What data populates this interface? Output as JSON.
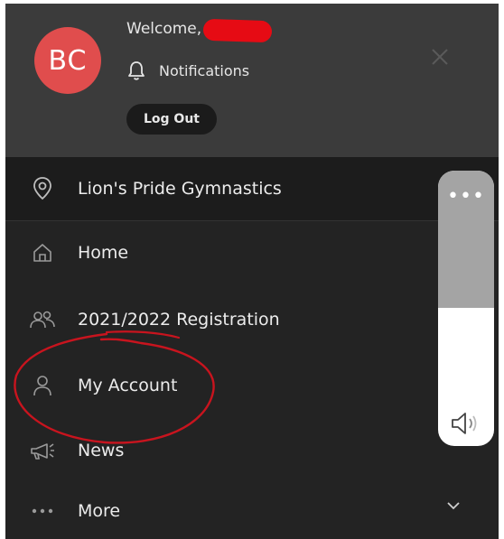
{
  "user": {
    "initials": "BC",
    "welcome": "Welcome,"
  },
  "header": {
    "notifications_label": "Notifications",
    "logout_label": "Log Out"
  },
  "menu": {
    "organization": "Lion's Pride Gymnastics",
    "items": [
      {
        "label": "Home",
        "icon": "home-icon"
      },
      {
        "label": "2021/2022 Registration",
        "icon": "users-icon"
      },
      {
        "label": "My Account",
        "icon": "person-icon"
      },
      {
        "label": "News",
        "icon": "megaphone-icon"
      },
      {
        "label": "More",
        "icon": "dots-icon"
      }
    ]
  },
  "scroll_overlay": {
    "dots": "•••",
    "icon": "speaker-icon"
  },
  "colors": {
    "avatar": "#e04d4d",
    "header_bg": "#3b3b3b",
    "menu_bg": "#232323",
    "annotation": "#c8141e"
  }
}
